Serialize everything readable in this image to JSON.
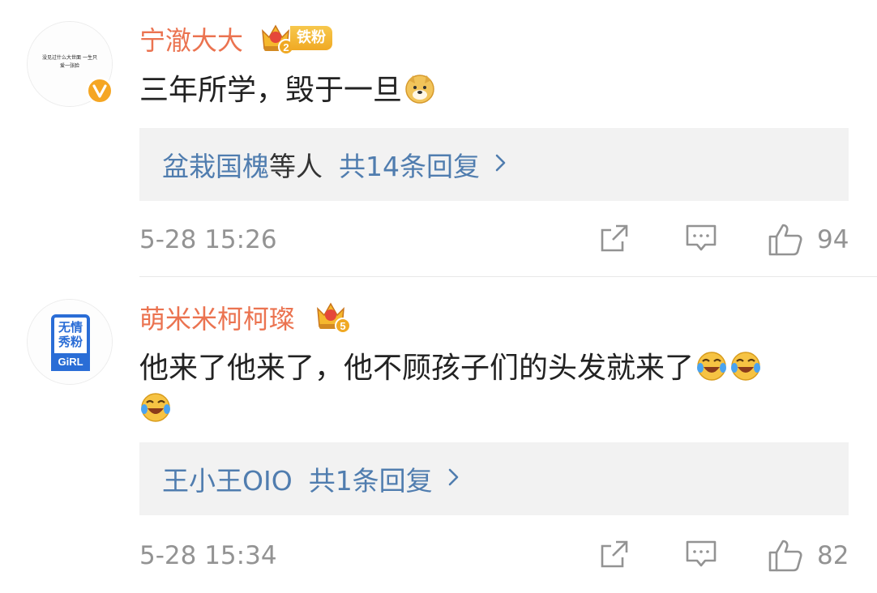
{
  "comments": [
    {
      "username": "宁澈大大",
      "avatar_text": "没见过什么大世面 一生只爱一张脸",
      "avatar_badge": "verified-v-icon",
      "level_badge": "crown-level-2-icon",
      "fan_label": "铁粉",
      "text": "三年所学，毁于一旦",
      "text_emoji": "doge-emoji",
      "reply_names": "盆栽国槐",
      "reply_mid": "等人",
      "reply_count": "共14条回复",
      "time": "5-28 15:26",
      "likes": "94"
    },
    {
      "username": "萌米米柯柯璨",
      "avatar_logo_line1": "无情",
      "avatar_logo_line2": "秀粉",
      "avatar_logo_bottom": "GiRL",
      "level_badge": "crown-level-5-icon",
      "text_line1": "他来了他来了，他不顾孩子们的头发就来了",
      "text_emoji": "laugh-cry-emoji",
      "reply_names": "王小王OIO",
      "reply_count": "共1条回复",
      "time": "5-28 15:34",
      "likes": "82"
    }
  ],
  "colors": {
    "username": "#eb7350",
    "link": "#507daf",
    "meta": "#939393",
    "reply_bg": "#f2f2f2"
  }
}
